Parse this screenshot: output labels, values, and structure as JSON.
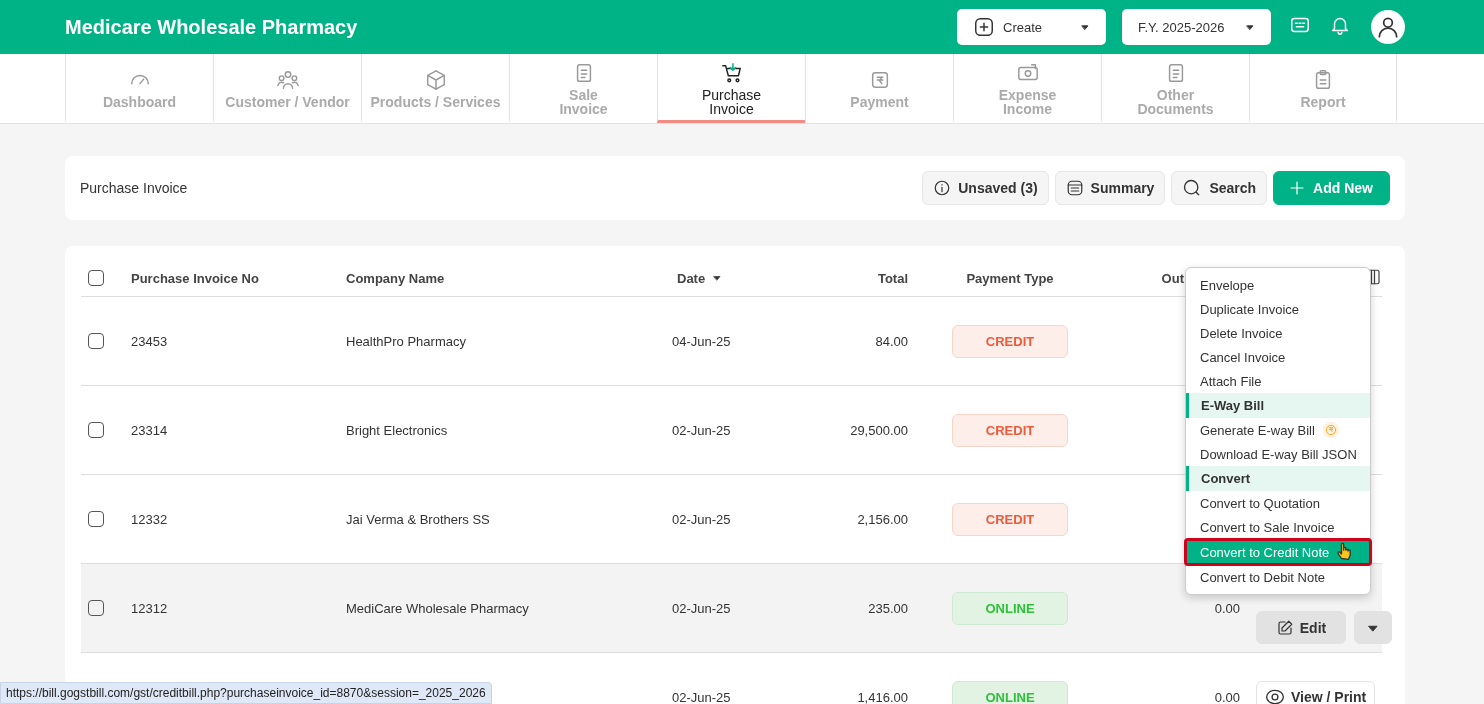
{
  "header": {
    "title": "Medicare Wholesale Pharmacy",
    "create_label": "Create",
    "fy_label": "F.Y. 2025-2026"
  },
  "nav_tabs": [
    {
      "label": "Dashboard",
      "selected": false
    },
    {
      "label": "Customer / Vendor",
      "selected": false
    },
    {
      "label": "Products / Services",
      "selected": false
    },
    {
      "label": "Sale\nInvoice",
      "selected": false
    },
    {
      "label": "Purchase\nInvoice",
      "selected": true
    },
    {
      "label": "Payment",
      "selected": false
    },
    {
      "label": "Expense\nIncome",
      "selected": false
    },
    {
      "label": "Other\nDocuments",
      "selected": false
    },
    {
      "label": "Report",
      "selected": false
    }
  ],
  "toolbar": {
    "title": "Purchase Invoice",
    "unsaved_label": "Unsaved (3)",
    "summary_label": "Summary",
    "search_label": "Search",
    "add_label": "Add New"
  },
  "table": {
    "select_all_checked": false,
    "columns": [
      "Purchase Invoice No",
      "Company Name",
      "Date",
      "Total",
      "Payment Type",
      "Out"
    ],
    "rows": [
      {
        "invoice_no": "23453",
        "company": "HealthPro Pharmacy",
        "date": "04-Jun-25",
        "total": "84.00",
        "payment": {
          "label": "CREDIT",
          "kind": "credit"
        },
        "checked": false,
        "hovered": false
      },
      {
        "invoice_no": "23314",
        "company": "Bright Electronics",
        "date": "02-Jun-25",
        "total": "29,500.00",
        "payment": {
          "label": "CREDIT",
          "kind": "credit"
        },
        "checked": false,
        "hovered": false
      },
      {
        "invoice_no": "12332",
        "company": "Jai Verma & Brothers SS",
        "date": "02-Jun-25",
        "total": "2,156.00",
        "payment": {
          "label": "CREDIT",
          "kind": "credit"
        },
        "checked": false,
        "hovered": false
      },
      {
        "invoice_no": "12312",
        "company": "MediCare Wholesale Pharmacy",
        "date": "02-Jun-25",
        "total": "235.00",
        "payment": {
          "label": "ONLINE",
          "kind": "online"
        },
        "outstanding": "0.00",
        "edit_label": "Edit",
        "checked": false,
        "hovered": true
      },
      {
        "date": "02-Jun-25",
        "total": "1,416.00",
        "payment": {
          "label": "ONLINE",
          "kind": "online"
        },
        "outstanding": "0.00",
        "view_label": "View / Print",
        "hovered": false
      }
    ]
  },
  "action_menu": [
    {
      "label": "Envelope",
      "kind": "item",
      "selected": false
    },
    {
      "label": "Duplicate Invoice",
      "kind": "item",
      "selected": false
    },
    {
      "label": "Delete Invoice",
      "kind": "item",
      "selected": false
    },
    {
      "label": "Cancel Invoice",
      "kind": "item",
      "selected": false
    },
    {
      "label": "Attach File",
      "kind": "item",
      "selected": false
    },
    {
      "label": "E-Way Bill",
      "kind": "header",
      "selected": false
    },
    {
      "label": "Generate E-way Bill",
      "kind": "paid",
      "selected": false
    },
    {
      "label": "Download E-way Bill JSON",
      "kind": "item",
      "selected": false
    },
    {
      "label": "Convert",
      "kind": "header",
      "selected": false
    },
    {
      "label": "Convert to Quotation",
      "kind": "item",
      "selected": false
    },
    {
      "label": "Convert to Sale Invoice",
      "kind": "item",
      "selected": false
    },
    {
      "label": "Convert to Credit Note",
      "kind": "item",
      "selected": true
    },
    {
      "label": "Convert to Debit Note",
      "kind": "item",
      "selected": false
    }
  ],
  "status_url": "https://bill.gogstbill.com/gst/creditbill.php?purchaseinvoice_id=8870&session=_2025_2026"
}
